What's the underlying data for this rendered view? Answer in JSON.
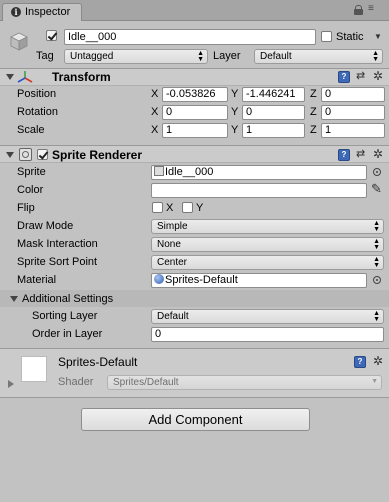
{
  "tab": {
    "title": "Inspector"
  },
  "object": {
    "name": "Idle__000",
    "static_label": "Static",
    "tag_label": "Tag",
    "tag_value": "Untagged",
    "layer_label": "Layer",
    "layer_value": "Default"
  },
  "transform": {
    "title": "Transform",
    "rows": [
      {
        "label": "Position",
        "x": "-0.053826",
        "y": "-1.446241",
        "z": "0"
      },
      {
        "label": "Rotation",
        "x": "0",
        "y": "0",
        "z": "0"
      },
      {
        "label": "Scale",
        "x": "1",
        "y": "1",
        "z": "1"
      }
    ],
    "axis_x": "X",
    "axis_y": "Y",
    "axis_z": "Z"
  },
  "sprite_renderer": {
    "title": "Sprite Renderer",
    "sprite_label": "Sprite",
    "sprite_value": "Idle__000",
    "color_label": "Color",
    "flip_label": "Flip",
    "flip_x": "X",
    "flip_y": "Y",
    "draw_mode_label": "Draw Mode",
    "draw_mode_value": "Simple",
    "mask_label": "Mask Interaction",
    "mask_value": "None",
    "sort_point_label": "Sprite Sort Point",
    "sort_point_value": "Center",
    "material_label": "Material",
    "material_value": "Sprites-Default",
    "additional_label": "Additional Settings",
    "sorting_layer_label": "Sorting Layer",
    "sorting_layer_value": "Default",
    "order_label": "Order in Layer",
    "order_value": "0"
  },
  "material": {
    "name": "Sprites-Default",
    "shader_label": "Shader",
    "shader_value": "Sprites/Default"
  },
  "add_component": {
    "label": "Add Component"
  }
}
